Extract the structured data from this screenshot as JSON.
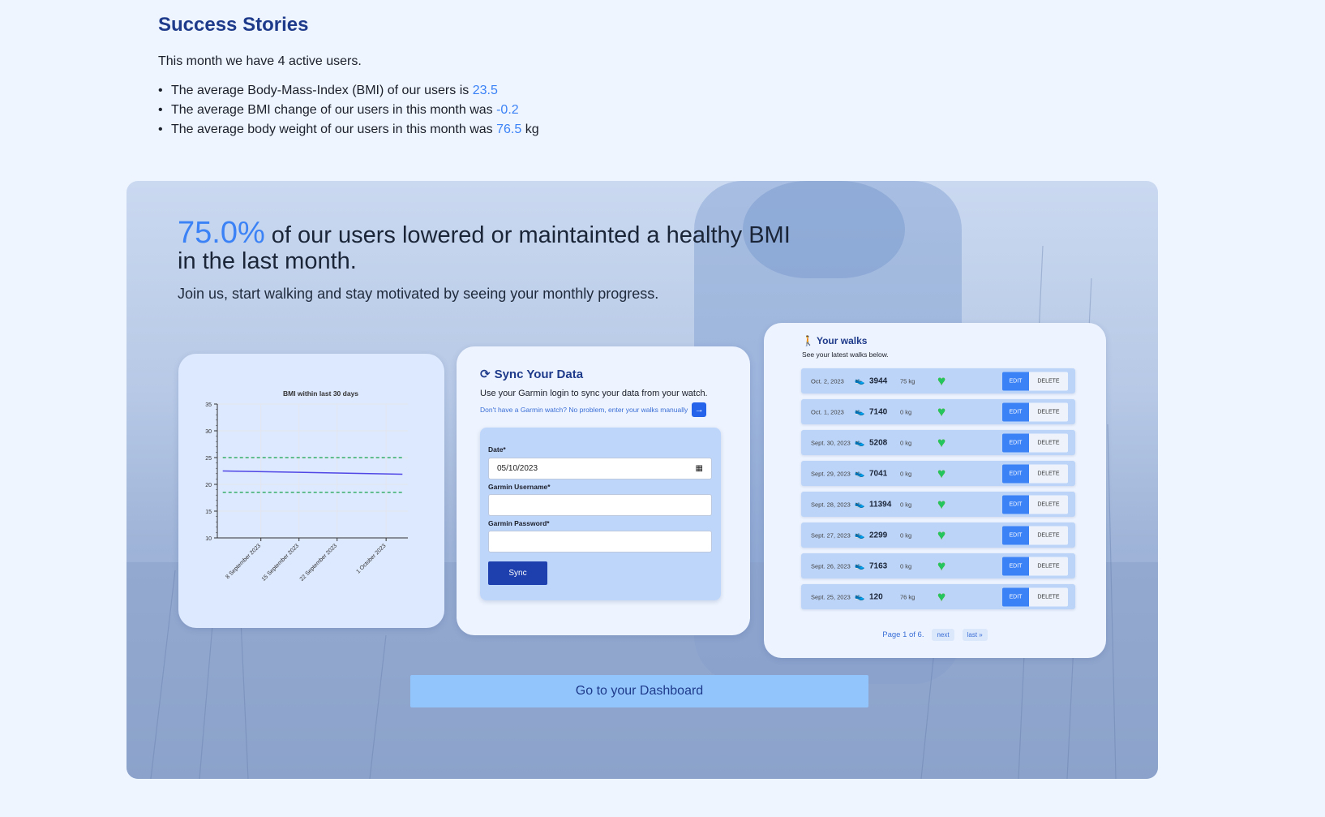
{
  "stories": {
    "title": "Success Stories",
    "intro": "This month we have 4 active users.",
    "stats": [
      {
        "text": "The average Body-Mass-Index (BMI) of our users is ",
        "value": "23.5",
        "suffix": ""
      },
      {
        "text": "The average BMI change of our users in this month was ",
        "value": "-0.2",
        "suffix": ""
      },
      {
        "text": "The average body weight of our users in this month was ",
        "value": "76.5",
        "suffix": " kg"
      }
    ]
  },
  "hero": {
    "percent": "75.0%",
    "headline": " of our users lowered or maintainted a healthy BMI in the last month.",
    "subline": "Join us, start walking and stay motivated by seeing your monthly progress.",
    "dashboard_button": "Go to your Dashboard"
  },
  "chart_data": {
    "type": "line",
    "title": "BMI within last 30 days",
    "x_tick_labels": [
      "8 September 2023",
      "15 September 2023",
      "22 September 2023",
      "1 October 2023"
    ],
    "ylim": [
      10,
      35
    ],
    "y_ticks": [
      10,
      15,
      20,
      25,
      30,
      35
    ],
    "series": [
      {
        "x": [
          "2023-09-01",
          "2023-10-04"
        ],
        "values": [
          22.5,
          21.9
        ],
        "color": "#4f46e5",
        "style": "solid"
      },
      {
        "x": [
          "2023-09-01",
          "2023-10-04"
        ],
        "values": [
          25,
          25
        ],
        "color": "#16a34a",
        "style": "dashed"
      },
      {
        "x": [
          "2023-09-01",
          "2023-10-04"
        ],
        "values": [
          18.5,
          18.5
        ],
        "color": "#16a34a",
        "style": "dashed"
      }
    ],
    "grid": true
  },
  "sync": {
    "title": "Sync Your Data",
    "desc": "Use your Garmin login to sync your data from your watch.",
    "link": "Don't have a Garmin watch? No problem, enter your walks manually",
    "date_label": "Date*",
    "date_value": "05/10/2023",
    "user_label": "Garmin Username*",
    "pass_label": "Garmin Password*",
    "button": "Sync"
  },
  "walks": {
    "title": "Your walks",
    "subtitle": "See your latest walks below.",
    "edit_label": "EDIT",
    "delete_label": "DELETE",
    "rows": [
      {
        "date": "Oct. 2, 2023",
        "steps": "3944",
        "kg": "75 kg"
      },
      {
        "date": "Oct. 1, 2023",
        "steps": "7140",
        "kg": "0 kg"
      },
      {
        "date": "Sept. 30, 2023",
        "steps": "5208",
        "kg": "0 kg"
      },
      {
        "date": "Sept. 29, 2023",
        "steps": "7041",
        "kg": "0 kg"
      },
      {
        "date": "Sept. 28, 2023",
        "steps": "11394",
        "kg": "0 kg"
      },
      {
        "date": "Sept. 27, 2023",
        "steps": "2299",
        "kg": "0 kg"
      },
      {
        "date": "Sept. 26, 2023",
        "steps": "7163",
        "kg": "0 kg"
      },
      {
        "date": "Sept. 25, 2023",
        "steps": "120",
        "kg": "76 kg"
      }
    ],
    "page_info": "Page 1 of 6.",
    "next": "next",
    "last": "last »"
  }
}
